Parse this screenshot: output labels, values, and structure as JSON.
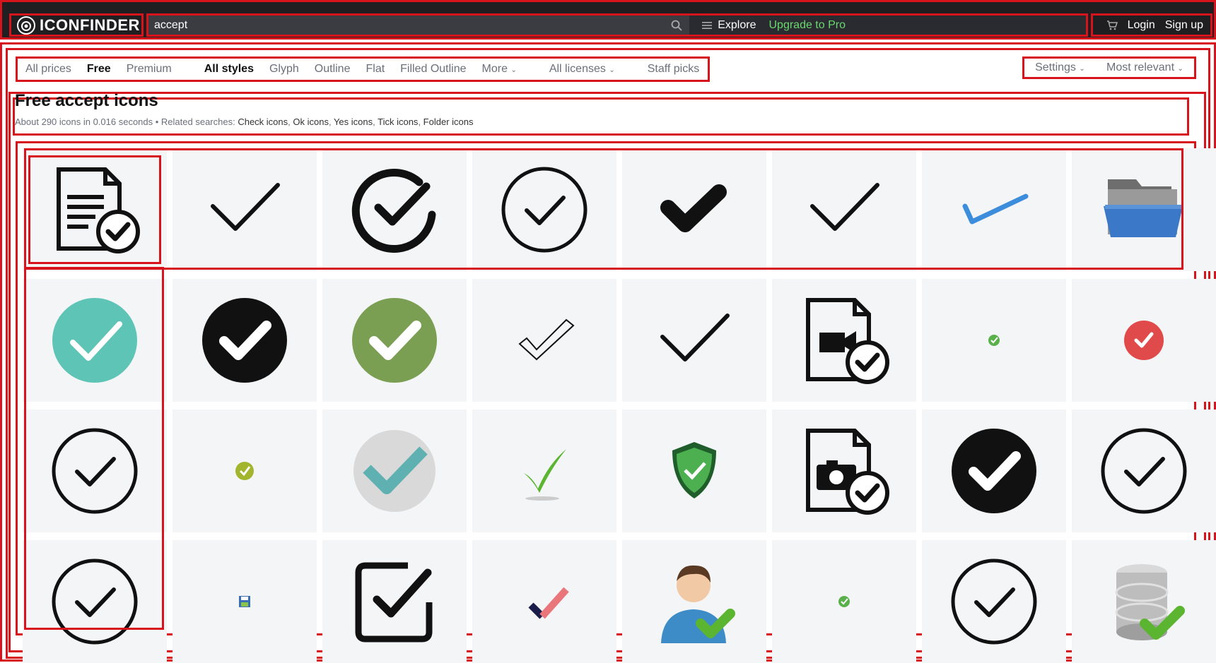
{
  "app": {
    "logo_text": "ICONFINDER"
  },
  "search": {
    "value": "accept",
    "explore_label": "Explore",
    "upgrade_label": "Upgrade to Pro"
  },
  "account": {
    "login_label": "Login",
    "signup_label": "Sign up"
  },
  "filters": {
    "prices": [
      "All prices",
      "Free",
      "Premium"
    ],
    "prices_active": "Free",
    "styles": [
      "All styles",
      "Glyph",
      "Outline",
      "Flat",
      "Filled Outline"
    ],
    "styles_active": "All styles",
    "more_label": "More",
    "licenses_label": "All licenses",
    "staff_picks_label": "Staff picks",
    "settings_label": "Settings",
    "sort_label": "Most relevant"
  },
  "results": {
    "title": "Free accept icons",
    "summary": "About 290 icons in 0.016 seconds",
    "related_prefix": "Related searches:",
    "related": [
      "Check icons",
      "Ok icons",
      "Yes icons",
      "Tick icons",
      "Folder icons"
    ]
  },
  "icons": [
    [
      "document-check-icon",
      "thin-check-icon",
      "circle-arc-check-icon",
      "circle-outline-check-icon",
      "bold-check-icon",
      "thin-check-icon",
      "blue-check-icon",
      "open-folder-icon"
    ],
    [
      "teal-circle-check-icon",
      "black-circle-check-icon",
      "green-circle-check-icon",
      "sketch-check-icon",
      "thin-check-icon",
      "video-file-check-icon",
      "tiny-green-check-icon",
      "red-circle-check-icon"
    ],
    [
      "circle-outline-check-icon",
      "tiny-yellow-check-icon",
      "gray-circle-teal-check-icon",
      "green-swoosh-check-icon",
      "shield-check-icon",
      "camera-file-check-icon",
      "black-circle-check-icon",
      "circle-outline-check-icon"
    ],
    [
      "circle-outline-check-icon",
      "floppy-icon",
      "checkbox-icon",
      "red-navy-check-icon",
      "user-check-icon",
      "tiny-green-check-icon",
      "circle-outline-check-icon",
      "database-check-icon"
    ]
  ],
  "colors": {
    "navbar_bg": "#1f1f22",
    "upgrade": "#6ad86f",
    "highlight": "#d7141c",
    "cell_bg": "#f4f5f7"
  }
}
